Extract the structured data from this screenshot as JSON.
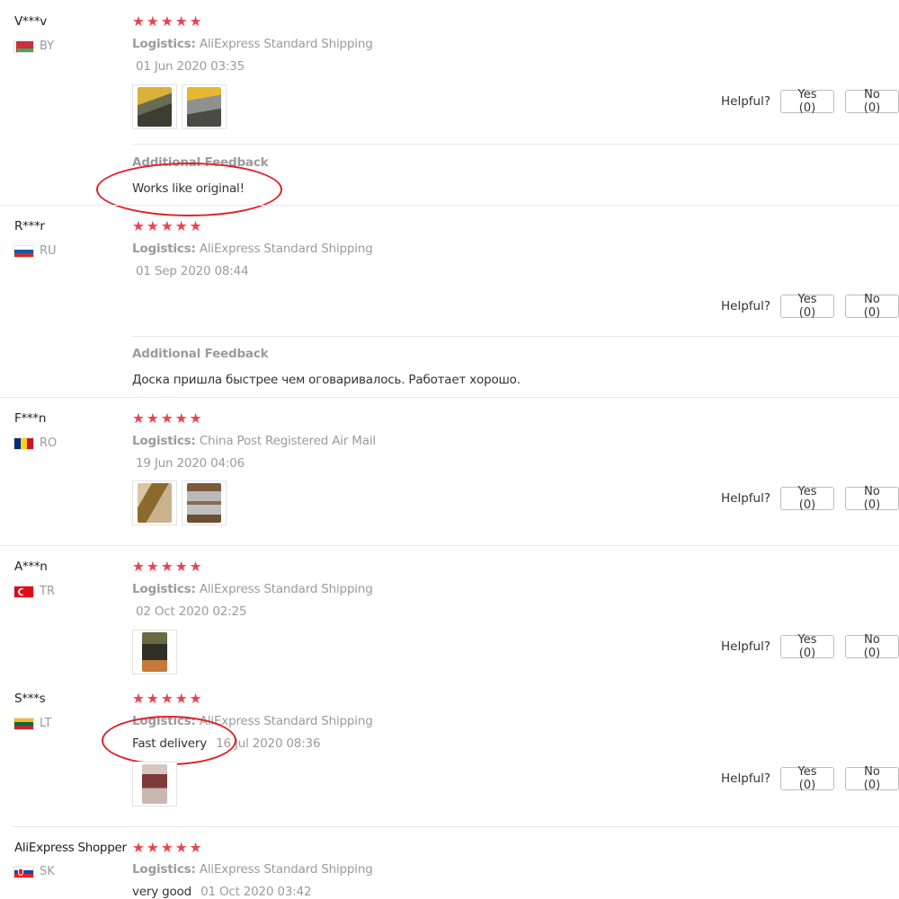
{
  "labels": {
    "logistics": "Logistics:",
    "helpful": "Helpful?",
    "additional_feedback": "Additional Feedback"
  },
  "colors": {
    "star": "#e9434f",
    "annotation": "#e0202a",
    "muted_text": "#9b9b9b"
  },
  "reviews": [
    {
      "user": "V***v",
      "country": "BY",
      "rating": 5,
      "logistics": "AliExpress Standard Shipping",
      "date": "01 Jun 2020 03:35",
      "photos": 2,
      "yes": "Yes (0)",
      "no": "No (0)",
      "additional_feedback": "Works like original!"
    },
    {
      "user": "R***r",
      "country": "RU",
      "rating": 5,
      "logistics": "AliExpress Standard Shipping",
      "date": "01 Sep 2020 08:44",
      "photos": 0,
      "yes": "Yes (0)",
      "no": "No (0)",
      "additional_feedback": "Доска пришла быстрее чем оговаривалось. Работает хорошо."
    },
    {
      "user": "F***n",
      "country": "RO",
      "rating": 5,
      "logistics": "China Post Registered Air Mail",
      "date": "19 Jun 2020 04:06",
      "photos": 2,
      "yes": "Yes (0)",
      "no": "No (0)"
    },
    {
      "user": "A***n",
      "country": "TR",
      "rating": 5,
      "logistics": "AliExpress Standard Shipping",
      "date": "02 Oct 2020 02:25",
      "photos": 1,
      "yes": "Yes (0)",
      "no": "No (0)"
    },
    {
      "user": "S***s",
      "country": "LT",
      "rating": 5,
      "logistics": "AliExpress Standard Shipping",
      "feedback": "Fast delivery",
      "date": "16 Jul 2020 08:36",
      "photos": 1,
      "yes": "Yes (0)",
      "no": "No (0)"
    },
    {
      "user": "AliExpress Shopper",
      "country": "SK",
      "rating": 5,
      "logistics": "AliExpress Standard Shipping",
      "feedback": "very good",
      "date": "01 Oct 2020 03:42"
    }
  ]
}
